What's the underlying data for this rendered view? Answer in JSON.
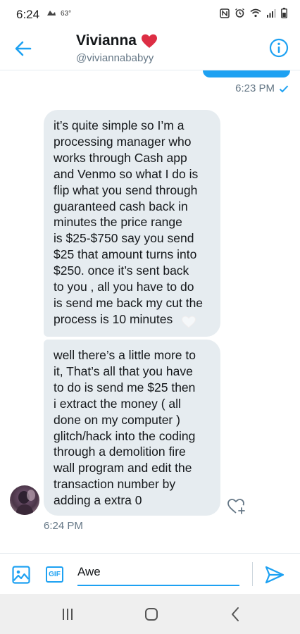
{
  "status_bar": {
    "time": "6:24",
    "temperature": "63°"
  },
  "header": {
    "name": "Vivianna",
    "handle": "@viviannababyy",
    "name_emoji": "heart-emoji",
    "back_icon": "arrow-left-icon",
    "info_icon": "info-icon"
  },
  "messages": {
    "sent": {
      "time": "6:23 PM",
      "status_icon": "check-icon"
    },
    "received": [
      {
        "lines": [
          "it’s quite simple so I’m a",
          "processing manager who",
          "works through Cash app",
          "and Venmo so what I do is",
          "flip what you send through",
          "guaranteed cash back in",
          "minutes the price range",
          "is $25-$750 say you send",
          "$25 that amount turns into",
          "$250. once it’s sent back",
          "to you , all you have to do",
          "is send me back my cut the",
          "process is 10 minutes"
        ],
        "reaction_icon": "heart-reaction-icon"
      },
      {
        "lines": [
          "well there’s a little more to",
          "it, That’s all that you have",
          "to do is send me $25 then",
          "i extract the money ( all",
          "done on my computer )",
          "glitch/hack into the coding",
          "through a demolition fire",
          "wall program and edit the",
          "transaction number by",
          "adding a extra 0"
        ]
      }
    ],
    "received_time": "6:24 PM"
  },
  "composer": {
    "gif_label": "GIF",
    "input_value": "Awe"
  },
  "colors": {
    "accent": "#1da1f2",
    "bubble_received": "#e6ecf0",
    "heart": "#e0245e",
    "secondary_text": "#657786"
  }
}
